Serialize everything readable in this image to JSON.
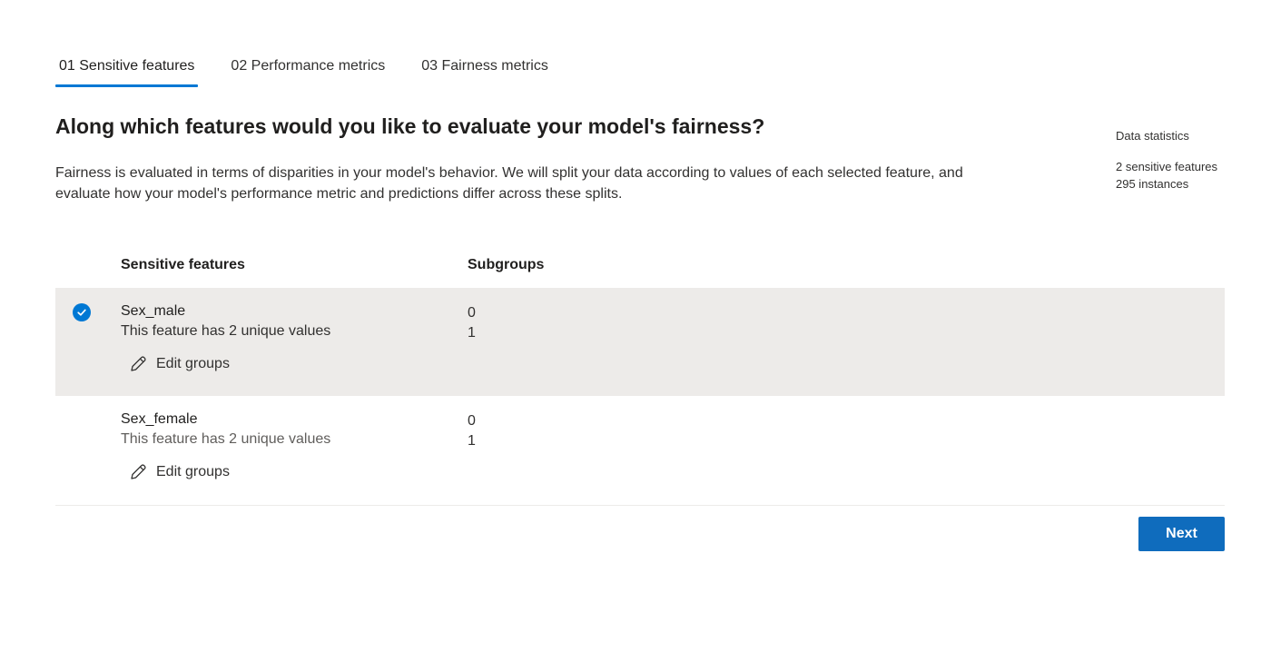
{
  "tabs": [
    {
      "label": "01 Sensitive features",
      "active": true
    },
    {
      "label": "02 Performance metrics",
      "active": false
    },
    {
      "label": "03 Fairness metrics",
      "active": false
    }
  ],
  "page": {
    "title": "Along which features would you like to evaluate your model's fairness?",
    "description": "Fairness is evaluated in terms of disparities in your model's behavior. We will split your data according to values of each selected feature, and evaluate how your model's performance metric and predictions differ across these splits."
  },
  "stats": {
    "title": "Data statistics",
    "sensitive_features": "2 sensitive features",
    "instances": "295 instances"
  },
  "table": {
    "headers": {
      "feature": "Sensitive features",
      "subgroups": "Subgroups"
    },
    "rows": [
      {
        "name": "Sex_male",
        "description": "This feature has 2 unique values",
        "edit_label": "Edit groups",
        "subgroups": [
          "0",
          "1"
        ],
        "selected": true
      },
      {
        "name": "Sex_female",
        "description": "This feature has 2 unique values",
        "edit_label": "Edit groups",
        "subgroups": [
          "0",
          "1"
        ],
        "selected": false
      }
    ]
  },
  "actions": {
    "next_label": "Next"
  },
  "colors": {
    "accent": "#0078d4",
    "selected_row": "#edebe9",
    "button": "#0f6cbd"
  },
  "icons": {
    "selected": "checkmark-circle-icon",
    "edit": "pencil-icon"
  }
}
